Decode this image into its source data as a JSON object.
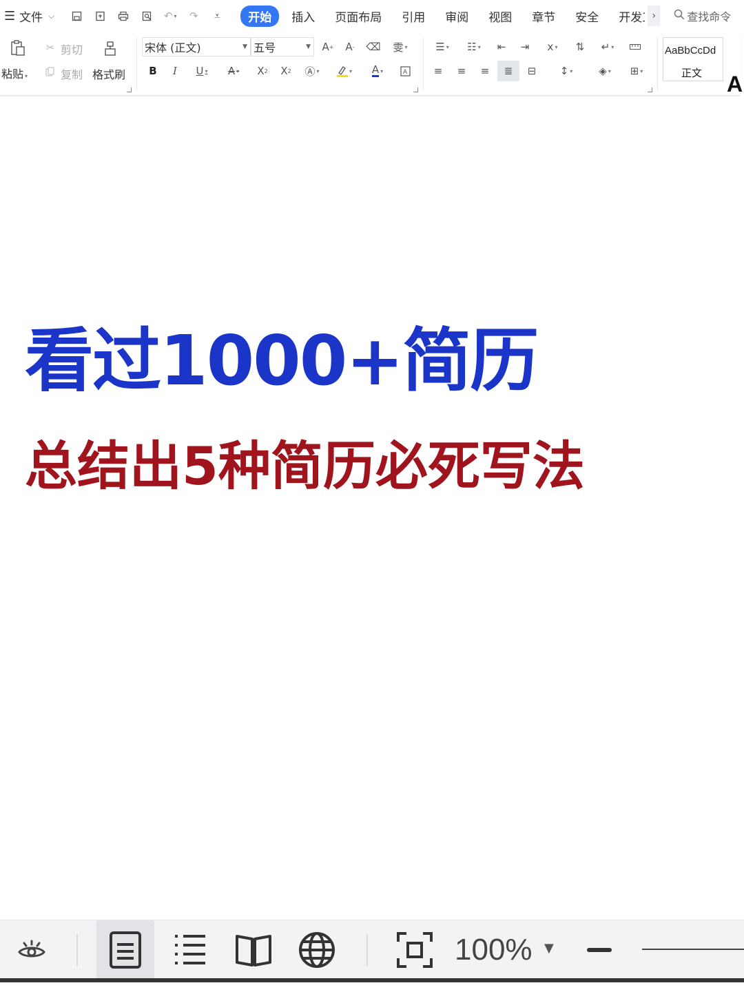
{
  "menubar": {
    "file_label": "文件",
    "tabs": [
      "开始",
      "插入",
      "页面布局",
      "引用",
      "审阅",
      "视图",
      "章节",
      "安全",
      "开发工具"
    ],
    "active_tab": "开始",
    "search_placeholder": "查找命令"
  },
  "ribbon": {
    "clipboard": {
      "paste": "粘贴",
      "cut": "剪切",
      "copy": "复制",
      "format_painter": "格式刷"
    },
    "font": {
      "family": "宋体 (正文)",
      "size": "五号"
    },
    "styles": {
      "sample": "AaBbCcDd",
      "normal": "正文",
      "next_sample": "A"
    }
  },
  "document": {
    "headline": "看过1000+简历",
    "subline": "总结出5种简历必死写法",
    "headline_color": "#1b35c9",
    "subline_color": "#a0141e"
  },
  "statusbar": {
    "zoom": "100%"
  },
  "icons": {
    "accent": "#3477f5"
  }
}
